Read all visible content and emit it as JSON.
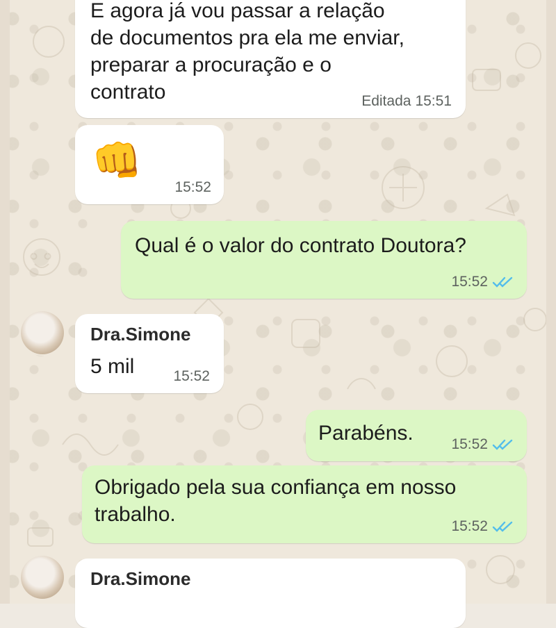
{
  "messages": [
    {
      "id": "m1",
      "dir": "in",
      "text": "E agora já vou passar a relação\nde documentos pra ela me enviar,\npreparar a procuração e o\ncontrato",
      "edited_label": "Editada",
      "time": "15:51"
    },
    {
      "id": "m2",
      "dir": "in",
      "emoji": "👊",
      "time": "15:52"
    },
    {
      "id": "m3",
      "dir": "out",
      "text": "Qual é o valor do contrato Doutora?",
      "time": "15:52"
    },
    {
      "id": "m4",
      "dir": "in",
      "sender": "Dra.Simone",
      "text": "5 mil",
      "time": "15:52"
    },
    {
      "id": "m5",
      "dir": "out",
      "text": "Parabéns.",
      "time": "15:52"
    },
    {
      "id": "m6",
      "dir": "out",
      "text": "Obrigado pela sua confiança em nosso\ntrabalho.",
      "time": "15:52"
    },
    {
      "id": "m7",
      "dir": "in",
      "sender": "Dra.Simone"
    }
  ],
  "colors": {
    "incoming_bubble": "#ffffff",
    "outgoing_bubble": "#dcf7c5",
    "read_ticks": "#53bdeb",
    "wallpaper": "#efe8dc"
  },
  "icons": {
    "read_receipt": "double-check-icon",
    "avatar": "contact-avatar"
  }
}
